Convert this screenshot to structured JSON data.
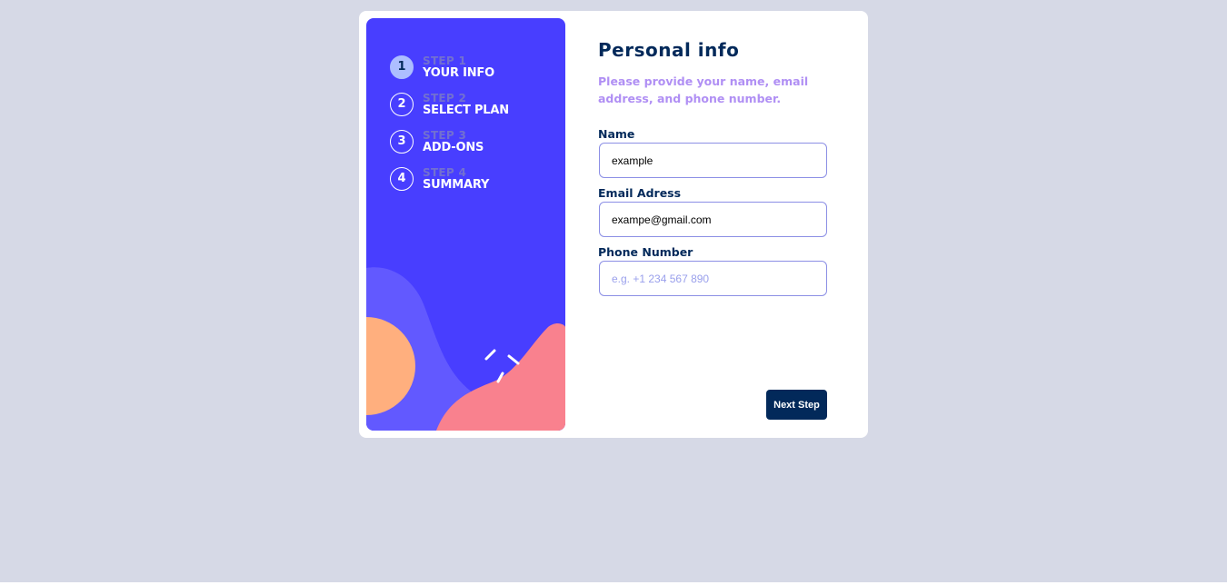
{
  "sidebar": {
    "steps": [
      {
        "number": "1",
        "sub": "STEP 1",
        "title": "YOUR INFO",
        "active": true
      },
      {
        "number": "2",
        "sub": "STEP 2",
        "title": "SELECT PLAN",
        "active": false
      },
      {
        "number": "3",
        "sub": "STEP 3",
        "title": "ADD-ONS",
        "active": false
      },
      {
        "number": "4",
        "sub": "STEP 4",
        "title": "SUMMARY",
        "active": false
      }
    ]
  },
  "main": {
    "title": "Personal info",
    "subtitle": "Please provide your name, email address, and phone number.",
    "fields": {
      "name": {
        "label": "Name",
        "value": "example",
        "placeholder": ""
      },
      "email": {
        "label": "Email Adress",
        "value": "exampe@gmail.com",
        "placeholder": ""
      },
      "phone": {
        "label": "Phone Number",
        "value": "",
        "placeholder": "e.g. +1 234 567 890"
      }
    },
    "next_label": "Next Step"
  },
  "colors": {
    "page_bg": "#d6d9e6",
    "sidebar_bg": "#483eff",
    "active_step": "#adbeff",
    "primary_text": "#02295a",
    "subtitle_text": "#b08ff4",
    "blob_light": "#6259ff",
    "blob_orange": "#ffaf7e",
    "blob_pink": "#f9818e"
  }
}
